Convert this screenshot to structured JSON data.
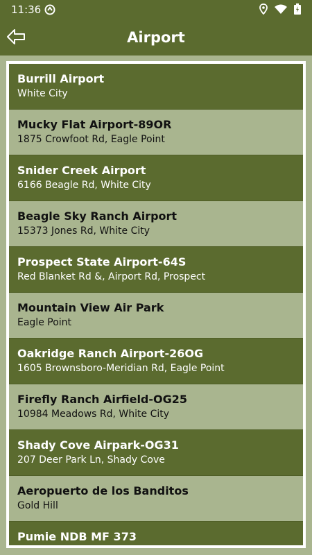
{
  "status": {
    "time": "11:36",
    "icons": [
      "app-notification-icon",
      "location-icon",
      "wifi-icon",
      "battery-icon"
    ]
  },
  "header": {
    "title": "Airport",
    "back_icon": "back-arrow-icon"
  },
  "colors": {
    "primary": "#5b6b2f",
    "light_row": "#a9b58f",
    "background": "#a9b58f",
    "frame": "#ffffff"
  },
  "airports": [
    {
      "name": "Burrill Airport",
      "address": "White City",
      "shade": "dark"
    },
    {
      "name": "Mucky Flat Airport-89OR",
      "address": "1875 Crowfoot Rd, Eagle Point",
      "shade": "light"
    },
    {
      "name": "Snider Creek Airport",
      "address": "6166 Beagle Rd, White City",
      "shade": "dark"
    },
    {
      "name": "Beagle Sky Ranch Airport",
      "address": "15373 Jones Rd, White City",
      "shade": "light"
    },
    {
      "name": "Prospect State Airport-64S",
      "address": "Red Blanket Rd &, Airport Rd, Prospect",
      "shade": "dark"
    },
    {
      "name": "Mountain View Air Park",
      "address": "Eagle Point",
      "shade": "light"
    },
    {
      "name": "Oakridge Ranch Airport-26OG",
      "address": "1605 Brownsboro-Meridian Rd, Eagle Point",
      "shade": "dark"
    },
    {
      "name": "Firefly Ranch Airfield-OG25",
      "address": "10984 Meadows Rd, White City",
      "shade": "light"
    },
    {
      "name": "Shady Cove Airpark-OG31",
      "address": "207 Deer Park Ln, Shady Cove",
      "shade": "dark"
    },
    {
      "name": "Aeropuerto de los Banditos",
      "address": "Gold Hill",
      "shade": "light"
    },
    {
      "name": "Pumie NDB MF 373",
      "address": "",
      "shade": "dark"
    }
  ]
}
